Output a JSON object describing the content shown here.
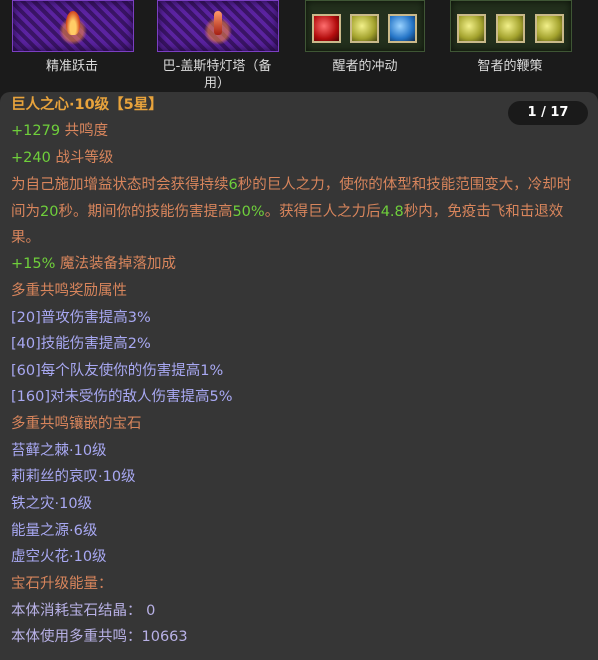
{
  "skills": [
    {
      "label": "精准跃击"
    },
    {
      "label": "巴-盖斯特灯塔（备用）"
    },
    {
      "label": "醒者的冲动"
    },
    {
      "label": "智者的鞭策"
    }
  ],
  "tooltip": {
    "title": "巨人之心·10级【5星】",
    "page_indicator": "1 / 17",
    "stat_resonance": {
      "value": "+1279",
      "label": "共鸣度"
    },
    "stat_combat": {
      "value": "+240",
      "label": "战斗等级"
    },
    "desc": {
      "p1": "为自己施加增益状态时会获得持续",
      "n1": "6",
      "p2": "秒的巨人之力，使你的体型和技能范围变大，冷却时间为",
      "n2": "20",
      "p3": "秒。期间你的技能伤害提高",
      "n3": "50%",
      "p4": "。获得巨人之力后",
      "n4": "4.8",
      "p5": "秒内，免疫击飞和击退效果。"
    },
    "magic_find": {
      "value": "+15%",
      "label": "魔法装备掉落加成"
    },
    "bonus_header": "多重共鸣奖励属性",
    "bonuses": [
      "[20]普攻伤害提高3%",
      "[40]技能伤害提高2%",
      "[60]每个队友使你的伤害提高1%",
      "[160]对未受伤的敌人伤害提高5%"
    ],
    "gems_header": "多重共鸣镶嵌的宝石",
    "gems": [
      "苔藓之棘·10级",
      "莉莉丝的哀叹·10级",
      "铁之灾·10级",
      "能量之源·6级",
      "虚空火花·10级"
    ],
    "upgrade_header": "宝石升级能量：",
    "consume": "本体消耗宝石结晶：  0",
    "use_multi": "本体使用多重共鸣：10663"
  },
  "colors": {
    "title": "#e8a33c",
    "stat": "#6fcf3b",
    "desc": "#d8855c",
    "bonus": "#a8a8f2",
    "panel_bg": "#363636"
  }
}
